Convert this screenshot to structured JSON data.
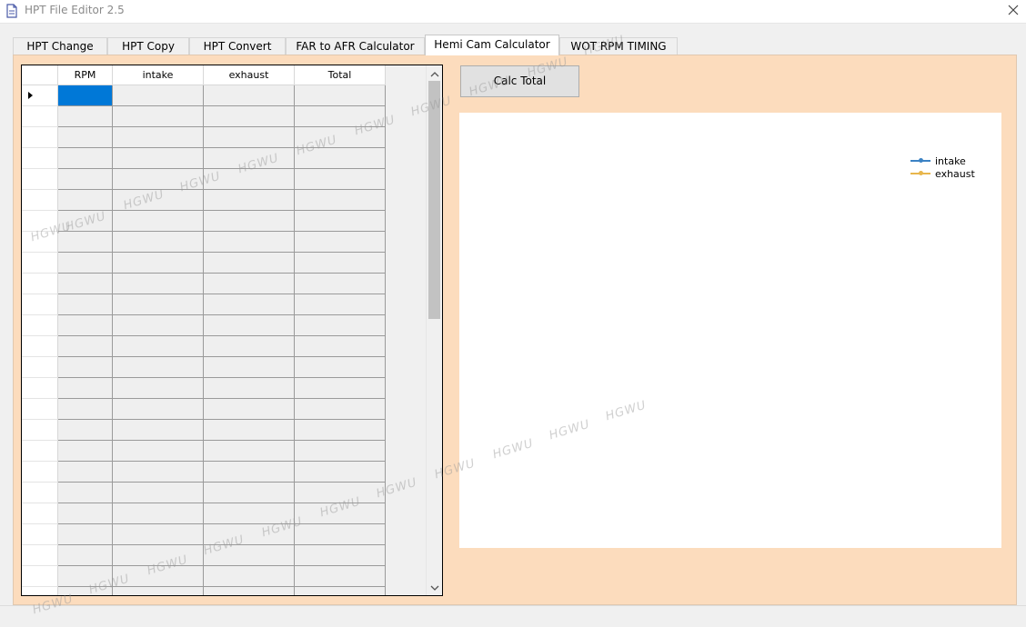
{
  "window": {
    "title": "HPT File Editor 2.5",
    "app_icon": "document-icon",
    "close_icon": "close-icon"
  },
  "tabs": [
    {
      "label": "HPT Change",
      "active": false
    },
    {
      "label": "HPT Copy",
      "active": false
    },
    {
      "label": "HPT Convert",
      "active": false
    },
    {
      "label": "FAR to AFR Calculator",
      "active": false
    },
    {
      "label": "Hemi Cam Calculator",
      "active": true
    },
    {
      "label": "WOT RPM TIMING",
      "active": false
    }
  ],
  "grid": {
    "columns": [
      "RPM",
      "intake",
      "exhaust",
      "Total"
    ],
    "selected_cell": {
      "row": 0,
      "col": 0
    },
    "current_row_icon": "row-pointer-icon"
  },
  "calc_button": {
    "label": "Calc Total"
  },
  "chart": {
    "legend": [
      {
        "name": "intake",
        "color": "#3b82c4"
      },
      {
        "name": "exhaust",
        "color": "#e8b64c"
      }
    ]
  },
  "watermark_text": "HGWU",
  "colors": {
    "panel_bg": "#fcdcbd",
    "selection": "#0078d7"
  }
}
